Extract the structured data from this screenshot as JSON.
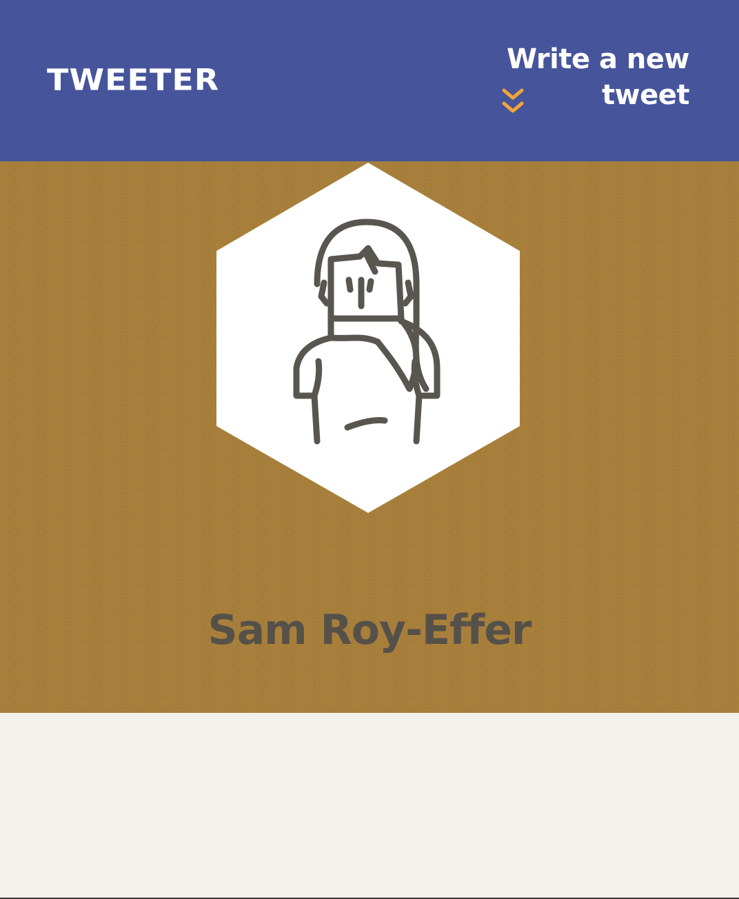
{
  "nav": {
    "brand": "TWEETER",
    "compose_label": "Write a new tweet",
    "compose_icon": "double-chevron-down-icon"
  },
  "profile": {
    "name": "Sam Roy-Effer",
    "avatar_icon": "woman-avatar-icon"
  },
  "colors": {
    "nav_bg": "#46559b",
    "profile_bg": "#a8803c",
    "accent": "#f4a636",
    "name_text": "#555149",
    "page_bg": "#f3f1ec"
  }
}
